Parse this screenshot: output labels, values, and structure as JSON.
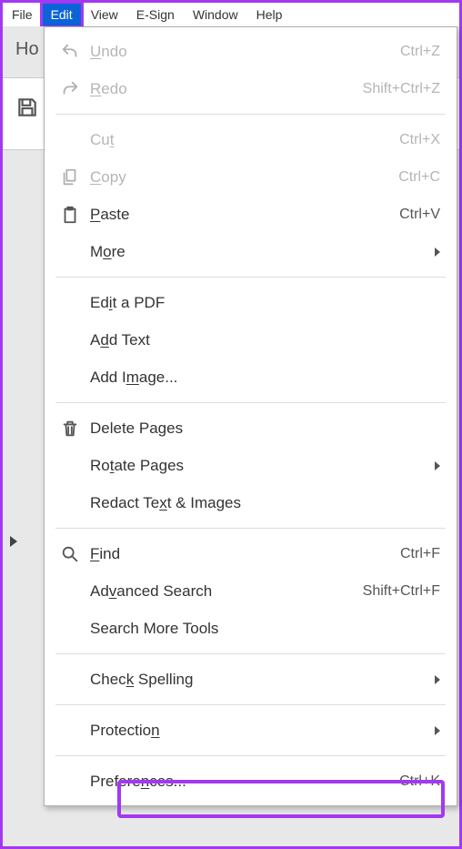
{
  "menubar": {
    "items": [
      {
        "label": "File"
      },
      {
        "label": "Edit",
        "selected": true
      },
      {
        "label": "View"
      },
      {
        "label": "E-Sign"
      },
      {
        "label": "Window"
      },
      {
        "label": "Help"
      }
    ]
  },
  "home_fragment": "Ho",
  "dropdown": {
    "groups": [
      [
        {
          "label_pre": "",
          "mn": "U",
          "label_post": "ndo",
          "accel": "Ctrl+Z",
          "disabled": true,
          "icon": "undo"
        },
        {
          "label_pre": "",
          "mn": "R",
          "label_post": "edo",
          "accel": "Shift+Ctrl+Z",
          "disabled": true,
          "icon": "redo"
        }
      ],
      [
        {
          "label_pre": "Cu",
          "mn": "t",
          "label_post": "",
          "accel": "Ctrl+X",
          "disabled": true
        },
        {
          "label_pre": "",
          "mn": "C",
          "label_post": "opy",
          "accel": "Ctrl+C",
          "disabled": true,
          "icon": "copy"
        },
        {
          "label_pre": "",
          "mn": "P",
          "label_post": "aste",
          "accel": "Ctrl+V",
          "icon": "paste"
        },
        {
          "label_pre": "M",
          "mn": "o",
          "label_post": "re",
          "submenu": true
        }
      ],
      [
        {
          "label_pre": "Ed",
          "mn": "i",
          "label_post": "t a PDF"
        },
        {
          "label_pre": "A",
          "mn": "d",
          "label_post": "d Text"
        },
        {
          "label_pre": "Add I",
          "mn": "m",
          "label_post": "age..."
        }
      ],
      [
        {
          "label_pre": "Delete Pages",
          "mn": "",
          "label_post": "",
          "icon": "trash"
        },
        {
          "label_pre": "Ro",
          "mn": "t",
          "label_post": "ate Pages",
          "submenu": true
        },
        {
          "label_pre": "Redact Te",
          "mn": "x",
          "label_post": "t & Images"
        }
      ],
      [
        {
          "label_pre": "",
          "mn": "F",
          "label_post": "ind",
          "accel": "Ctrl+F",
          "icon": "search"
        },
        {
          "label_pre": "Ad",
          "mn": "v",
          "label_post": "anced Search",
          "accel": "Shift+Ctrl+F"
        },
        {
          "label_pre": "Search More Tools",
          "mn": "",
          "label_post": ""
        }
      ],
      [
        {
          "label_pre": "Chec",
          "mn": "k",
          "label_post": " Spelling",
          "submenu": true
        }
      ],
      [
        {
          "label_pre": "Protectio",
          "mn": "n",
          "label_post": "",
          "submenu": true
        }
      ],
      [
        {
          "label_pre": "Prefere",
          "mn": "n",
          "label_post": "ces...",
          "accel": "Ctrl+K"
        }
      ]
    ]
  }
}
